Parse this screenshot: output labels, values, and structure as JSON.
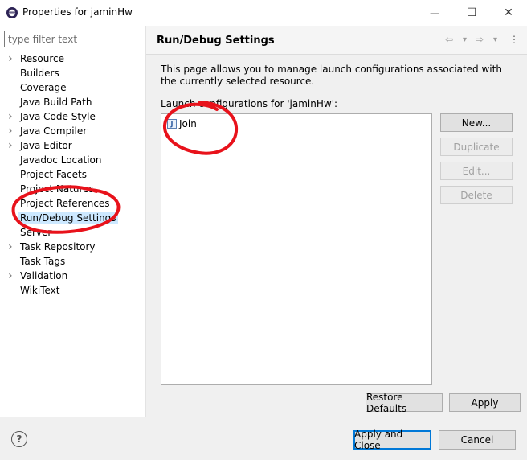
{
  "window": {
    "title": "Properties for jaminHw",
    "minimize_glyph": "—",
    "maximize_glyph": "☐",
    "close_glyph": "✕"
  },
  "filter": {
    "placeholder": "type filter text",
    "value": ""
  },
  "tree": [
    {
      "label": "Resource",
      "expandable": true
    },
    {
      "label": "Builders",
      "expandable": false
    },
    {
      "label": "Coverage",
      "expandable": false
    },
    {
      "label": "Java Build Path",
      "expandable": false
    },
    {
      "label": "Java Code Style",
      "expandable": true
    },
    {
      "label": "Java Compiler",
      "expandable": true
    },
    {
      "label": "Java Editor",
      "expandable": true
    },
    {
      "label": "Javadoc Location",
      "expandable": false
    },
    {
      "label": "Project Facets",
      "expandable": false
    },
    {
      "label": "Project Natures",
      "expandable": false
    },
    {
      "label": "Project References",
      "expandable": false
    },
    {
      "label": "Run/Debug Settings",
      "expandable": false,
      "selected": true
    },
    {
      "label": "Server",
      "expandable": false
    },
    {
      "label": "Task Repository",
      "expandable": true
    },
    {
      "label": "Task Tags",
      "expandable": false
    },
    {
      "label": "Validation",
      "expandable": true
    },
    {
      "label": "WikiText",
      "expandable": false
    }
  ],
  "page": {
    "title": "Run/Debug Settings",
    "description": "This page allows you to manage launch configurations associated with the currently selected resource.",
    "launch_label": "Launch configurations for 'jaminHw':",
    "configurations": [
      {
        "label": "Join",
        "icon": "java-icon",
        "icon_glyph": "J"
      }
    ]
  },
  "buttons": {
    "new": "New...",
    "duplicate": "Duplicate",
    "edit": "Edit...",
    "delete": "Delete",
    "restore_defaults": "Restore Defaults",
    "apply": "Apply",
    "apply_and_close": "Apply and Close",
    "cancel": "Cancel"
  },
  "help": {
    "glyph": "?"
  },
  "nav_icons": {
    "back": "⇦",
    "back_menu": "▾",
    "forward": "⇨",
    "forward_menu": "▾",
    "more": "⋮"
  },
  "colors": {
    "annotation": "#e8121b",
    "selection": "#cce8ff",
    "default_button_border": "#0078d7"
  }
}
